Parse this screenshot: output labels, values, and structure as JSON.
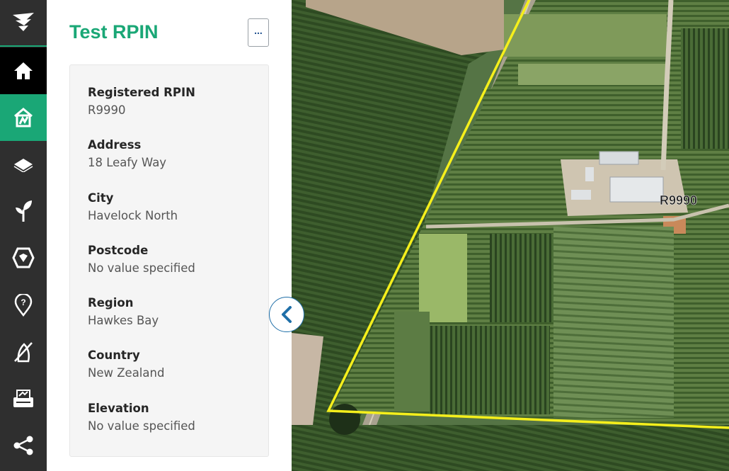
{
  "nav": {
    "items": [
      {
        "name": "logo",
        "icon": "logo-icon"
      },
      {
        "name": "home",
        "icon": "home-icon"
      },
      {
        "name": "rpin",
        "icon": "property-icon"
      },
      {
        "name": "layers",
        "icon": "layers-icon"
      },
      {
        "name": "crops",
        "icon": "seedling-icon"
      },
      {
        "name": "blocks",
        "icon": "shield-icon"
      },
      {
        "name": "help",
        "icon": "help-pin-icon"
      },
      {
        "name": "spray",
        "icon": "spray-icon"
      },
      {
        "name": "print",
        "icon": "print-icon"
      },
      {
        "name": "share",
        "icon": "share-icon"
      }
    ]
  },
  "panel": {
    "title": "Test RPIN",
    "more_label": "...",
    "fields": [
      {
        "label": "Registered RPIN",
        "value": "R9990"
      },
      {
        "label": "Address",
        "value": "18 Leafy Way"
      },
      {
        "label": "City",
        "value": "Havelock North"
      },
      {
        "label": "Postcode",
        "value": "No value specified"
      },
      {
        "label": "Region",
        "value": "Hawkes Bay"
      },
      {
        "label": "Country",
        "value": "New Zealand"
      },
      {
        "label": "Elevation",
        "value": "No value specified"
      }
    ]
  },
  "map": {
    "parcel_label": "R9990",
    "boundary_color": "#f5ef1c"
  },
  "colors": {
    "accent": "#1aa776",
    "rail": "#2f2f2f",
    "home_bg": "#000000",
    "button_blue": "#1f6fa8"
  }
}
